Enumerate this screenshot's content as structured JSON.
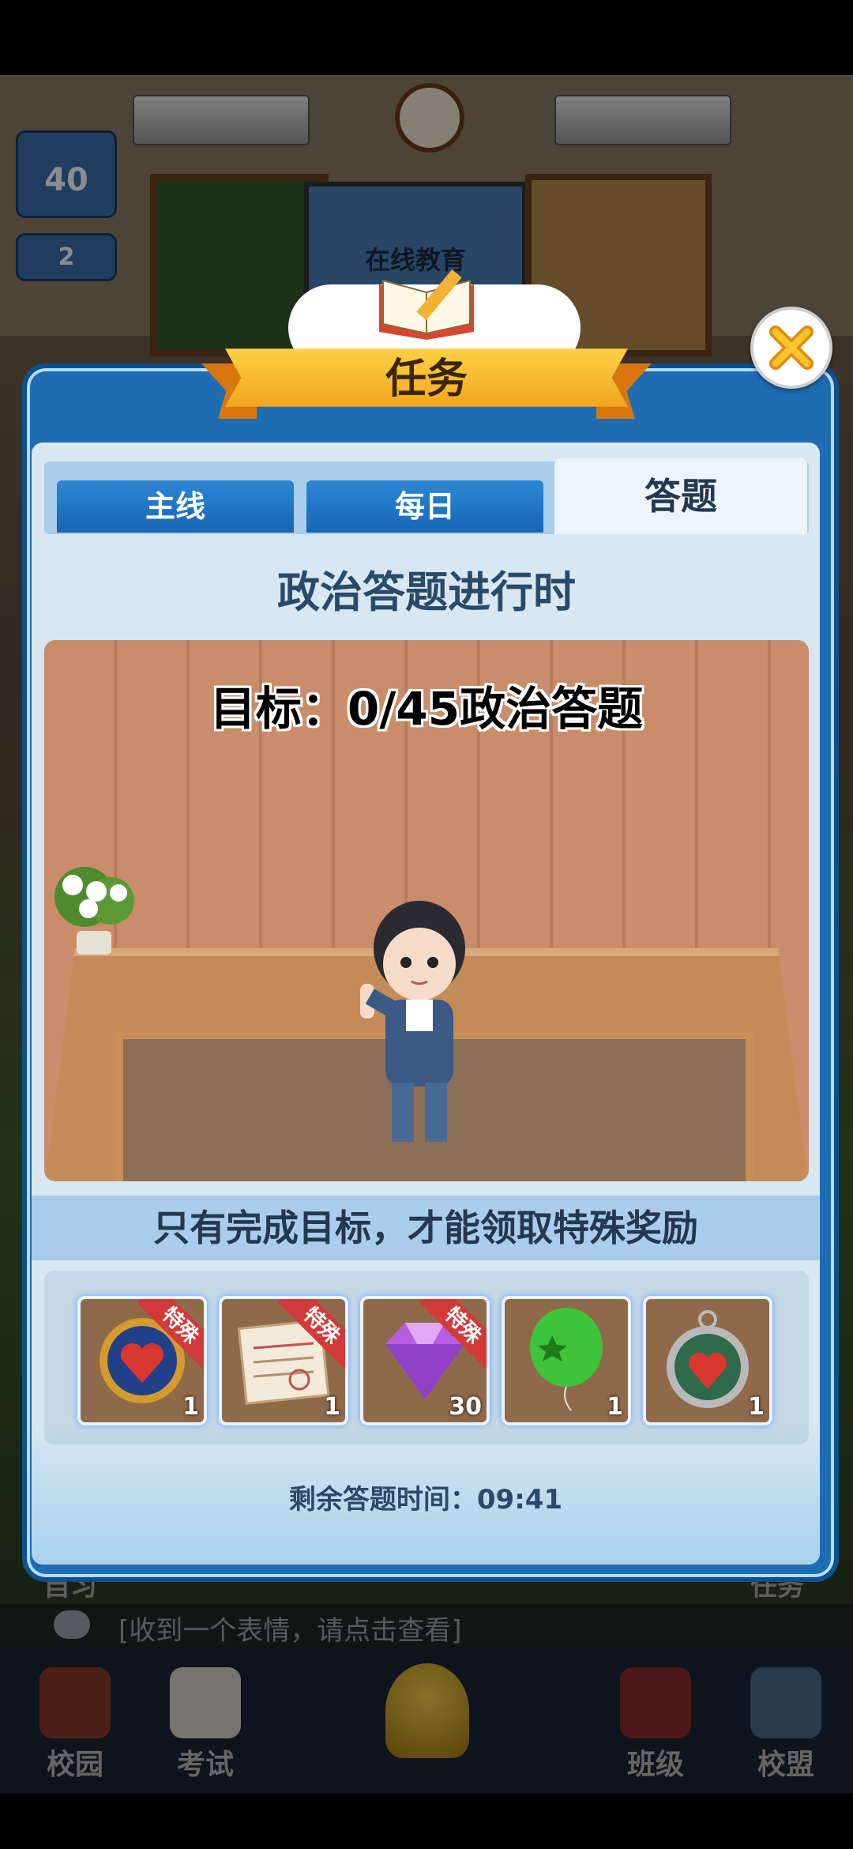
{
  "background": {
    "classroom_screen_text": "在线教育",
    "side_badges": [
      "40",
      "2"
    ],
    "left_label_cut": "自习",
    "right_label_cut": "任务",
    "chat_message": "[收到一个表情，请点击查看]"
  },
  "nav": {
    "items": [
      {
        "label": "校园",
        "icon": "campus-icon"
      },
      {
        "label": "考试",
        "icon": "exam-icon"
      },
      {
        "label": "班级",
        "icon": "class-icon"
      },
      {
        "label": "校盟",
        "icon": "alliance-icon"
      }
    ],
    "center_icon": "bell-icon"
  },
  "dialog": {
    "title": "任务",
    "tabs": [
      {
        "label": "主线",
        "active": false
      },
      {
        "label": "每日",
        "active": false
      },
      {
        "label": "答题",
        "active": true
      }
    ],
    "heading": "政治答题进行时",
    "goal_text": "目标：0/45政治答题",
    "hint": "只有完成目标，才能领取特殊奖励",
    "rewards": [
      {
        "icon": "compass-heart-icon",
        "count": "1",
        "tag": "特殊"
      },
      {
        "icon": "receipt-icon",
        "count": "1",
        "tag": "特殊"
      },
      {
        "icon": "diamond-icon",
        "count": "30",
        "tag": "特殊"
      },
      {
        "icon": "green-balloon-icon",
        "count": "1",
        "tag": ""
      },
      {
        "icon": "pocket-watch-icon",
        "count": "1",
        "tag": ""
      }
    ],
    "timer_label": "剩余答题时间：",
    "timer_value": "09:41"
  },
  "colors": {
    "dialog_blue": "#1e6db3",
    "panel_bg": "#d8e7f1",
    "ribbon": "#f0a019",
    "special_tag": "#d23a3a"
  }
}
